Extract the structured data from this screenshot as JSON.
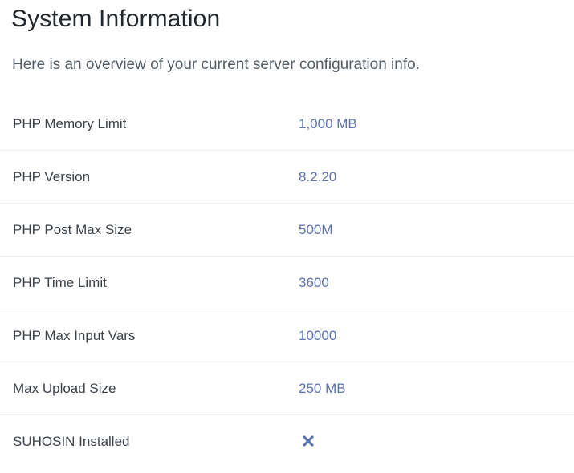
{
  "header": {
    "title": "System Information",
    "description": "Here is an overview of your current server configuration info."
  },
  "rows": [
    {
      "label": "PHP Memory Limit",
      "value": "1,000 MB"
    },
    {
      "label": "PHP Version",
      "value": "8.2.20"
    },
    {
      "label": "PHP Post Max Size",
      "value": "500M"
    },
    {
      "label": "PHP Time Limit",
      "value": "3600"
    },
    {
      "label": "PHP Max Input Vars",
      "value": "10000"
    },
    {
      "label": "Max Upload Size",
      "value": "250 MB"
    },
    {
      "label": "SUHOSIN Installed",
      "icon": "x-icon"
    }
  ],
  "colors": {
    "value_text": "#5b74b0",
    "icon": "#5b74b0"
  }
}
